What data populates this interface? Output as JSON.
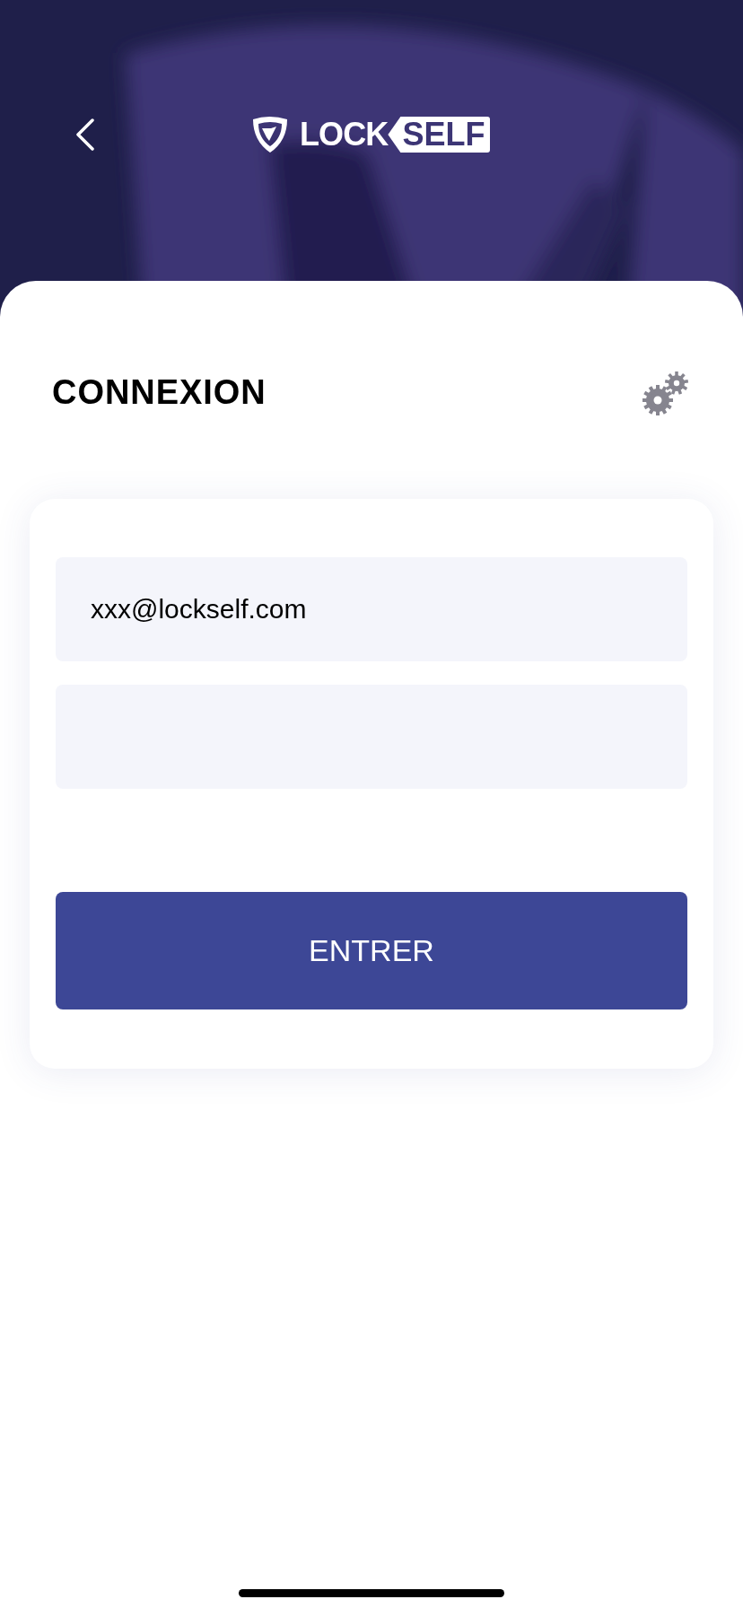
{
  "header": {
    "logo": {
      "word_1": "LOCK",
      "word_2": "SELF"
    }
  },
  "title": "CONNEXION",
  "form": {
    "fields": [
      {
        "kind": "email",
        "value": "xxx@lockself.com"
      },
      {
        "kind": "password"
      }
    ],
    "submit": "ENTRER"
  }
}
